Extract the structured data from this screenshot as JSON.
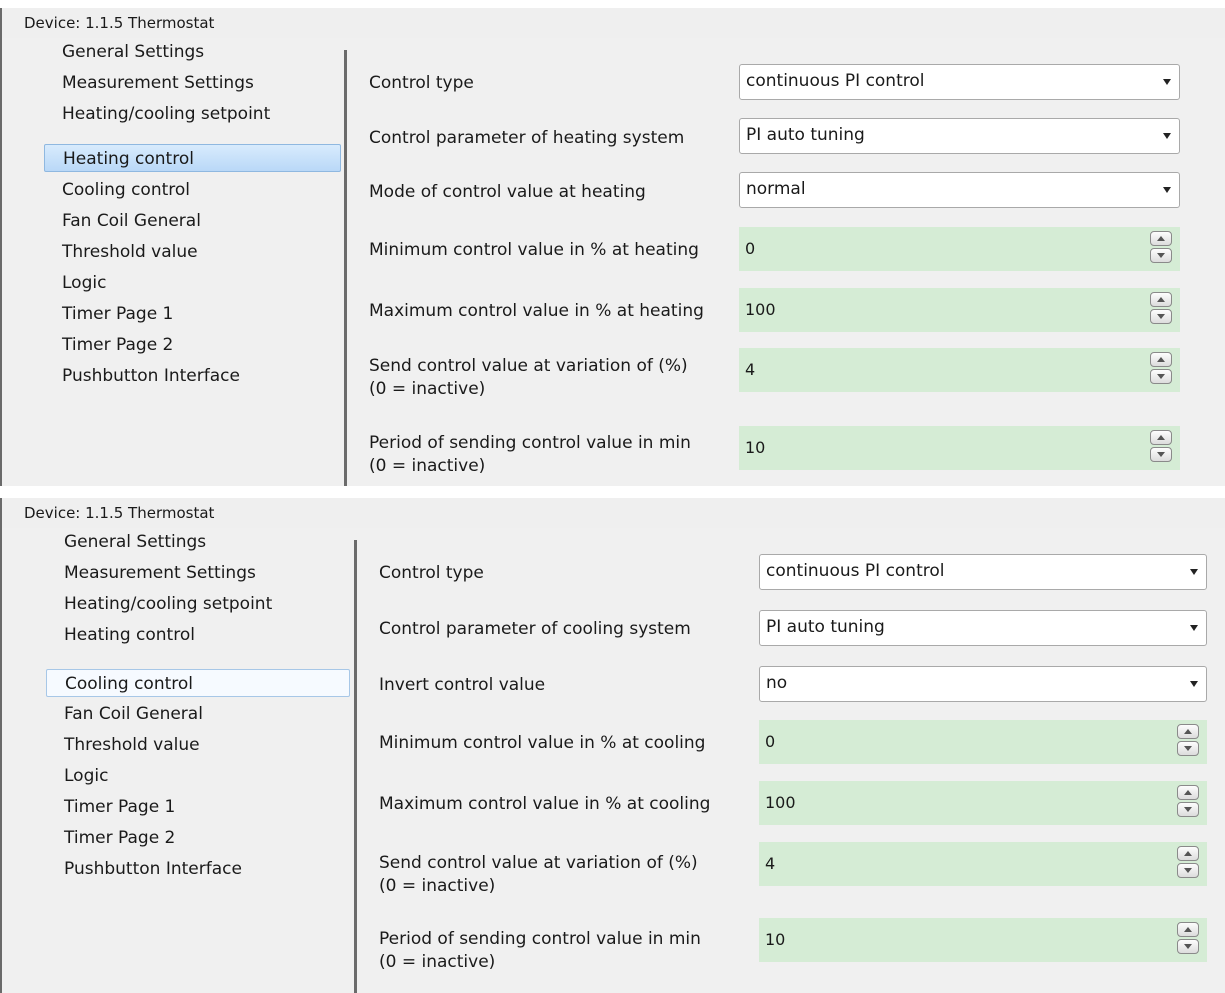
{
  "panels": [
    {
      "title": "Device: 1.1.5  Thermostat",
      "nav_items": [
        "General Settings",
        "Measurement Settings",
        "Heating/cooling setpoint",
        "Heating control",
        "Cooling control",
        "Fan Coil General",
        "Threshold value",
        "Logic",
        "Timer Page 1",
        "Timer Page 2",
        "Pushbutton Interface"
      ],
      "selected_item": "Heating control",
      "params": [
        {
          "label": "Control type",
          "value": "continuous PI control"
        },
        {
          "label": "Control parameter of heating system",
          "value": "PI auto tuning"
        },
        {
          "label": "Mode of control value at heating",
          "value": "normal"
        },
        {
          "label": "Minimum control value in % at heating",
          "value": "0"
        },
        {
          "label": "Maximum control value in % at heating",
          "value": "100"
        },
        {
          "label": "Send control value at variation of (%)",
          "label2": "(0 = inactive)",
          "value": "4"
        },
        {
          "label": "Period of sending control value in min",
          "label2": "(0 = inactive)",
          "value": "10"
        }
      ]
    },
    {
      "title": "Device: 1.1.5  Thermostat",
      "nav_items": [
        "General Settings",
        "Measurement Settings",
        "Heating/cooling setpoint",
        "Heating control",
        "Cooling control",
        "Fan Coil General",
        "Threshold value",
        "Logic",
        "Timer Page 1",
        "Timer Page 2",
        "Pushbutton Interface"
      ],
      "selected_item": "Cooling control",
      "params": [
        {
          "label": "Control type",
          "value": "continuous PI control"
        },
        {
          "label": "Control parameter of cooling system",
          "value": "PI auto tuning"
        },
        {
          "label": "Invert control value",
          "value": "no"
        },
        {
          "label": "Minimum control value in % at cooling",
          "value": "0"
        },
        {
          "label": "Maximum control value in % at cooling",
          "value": "100"
        },
        {
          "label": "Send control value at variation of (%)",
          "label2": "(0 = inactive)",
          "value": "4"
        },
        {
          "label": "Period of sending control value in min",
          "label2": "(0 = inactive)",
          "value": "10"
        }
      ]
    }
  ],
  "colors": {
    "selected_bg": "#c6e0fa",
    "number_field_bg": "#d5ecd5",
    "panel_bg": "#f0f0f0"
  },
  "icons": {
    "dropdown": "chevron-down-icon",
    "spin_up": "arrow-up-icon",
    "spin_down": "arrow-down-icon"
  }
}
